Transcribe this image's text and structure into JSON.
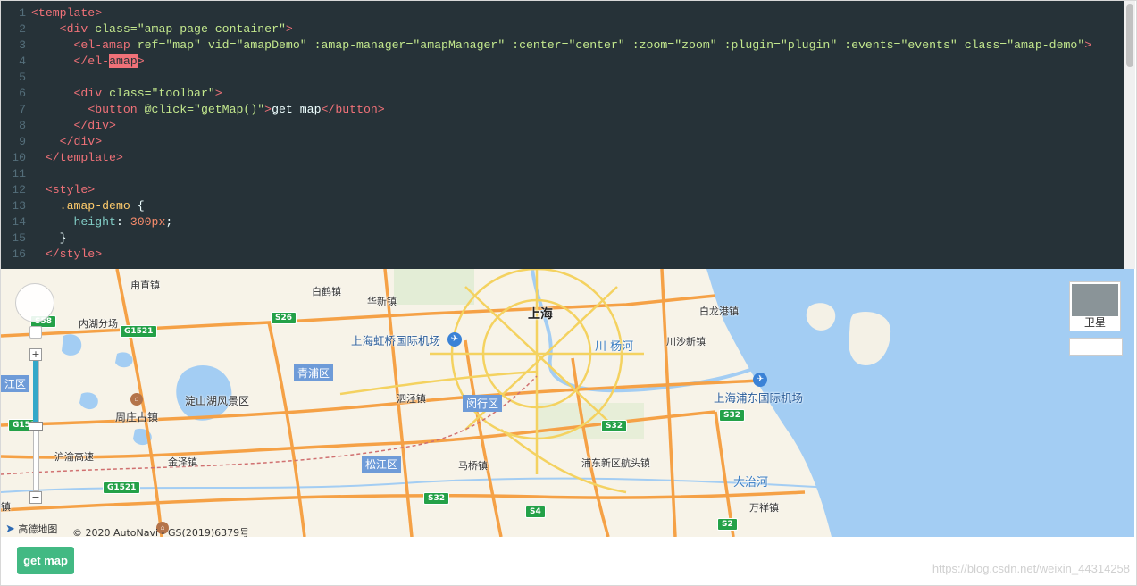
{
  "code": {
    "lines": [
      {
        "n": "1",
        "parts": [
          [
            "tag",
            "<template>"
          ]
        ]
      },
      {
        "n": "2",
        "parts": [
          [
            "plain",
            "    "
          ],
          [
            "tag",
            "<div "
          ],
          [
            "attr",
            "class="
          ],
          [
            "str",
            "\"amap-page-container\""
          ],
          [
            "tag",
            ">"
          ]
        ]
      },
      {
        "n": "3",
        "parts": [
          [
            "plain",
            "      "
          ],
          [
            "tag",
            "<el-amap "
          ],
          [
            "attr",
            "ref="
          ],
          [
            "str",
            "\"map\" "
          ],
          [
            "attr",
            "vid="
          ],
          [
            "str",
            "\"amapDemo\" "
          ],
          [
            "attr",
            ":amap-manager="
          ],
          [
            "str",
            "\"amapManager\" "
          ],
          [
            "attr",
            ":center="
          ],
          [
            "str",
            "\"center\" "
          ],
          [
            "attr",
            ":zoom="
          ],
          [
            "str",
            "\"zoom\" "
          ],
          [
            "attr",
            ":plugin="
          ],
          [
            "str",
            "\"plugin\" "
          ],
          [
            "attr",
            ":events="
          ],
          [
            "str",
            "\"events\" "
          ],
          [
            "attr",
            "class="
          ],
          [
            "str",
            "\"amap-demo\""
          ],
          [
            "tag",
            ">"
          ]
        ]
      },
      {
        "n": "4",
        "parts": [
          [
            "plain",
            "      "
          ],
          [
            "tag",
            "</el-"
          ],
          [
            "hl",
            "amap"
          ],
          [
            "tag",
            ">"
          ]
        ]
      },
      {
        "n": "5",
        "parts": []
      },
      {
        "n": "6",
        "parts": [
          [
            "plain",
            "      "
          ],
          [
            "tag",
            "<div "
          ],
          [
            "attr",
            "class="
          ],
          [
            "str",
            "\"toolbar\""
          ],
          [
            "tag",
            ">"
          ]
        ]
      },
      {
        "n": "7",
        "parts": [
          [
            "plain",
            "        "
          ],
          [
            "tag",
            "<button "
          ],
          [
            "attr",
            "@click="
          ],
          [
            "str",
            "\"getMap()\""
          ],
          [
            "tag",
            ">"
          ],
          [
            "plain",
            "get map"
          ],
          [
            "tag",
            "</button>"
          ]
        ]
      },
      {
        "n": "8",
        "parts": [
          [
            "plain",
            "      "
          ],
          [
            "tag",
            "</div>"
          ]
        ]
      },
      {
        "n": "9",
        "parts": [
          [
            "plain",
            "    "
          ],
          [
            "tag",
            "</div>"
          ]
        ]
      },
      {
        "n": "10",
        "parts": [
          [
            "plain",
            "  "
          ],
          [
            "tag",
            "</template>"
          ]
        ]
      },
      {
        "n": "11",
        "parts": []
      },
      {
        "n": "12",
        "parts": [
          [
            "plain",
            "  "
          ],
          [
            "tag",
            "<style>"
          ]
        ]
      },
      {
        "n": "13",
        "parts": [
          [
            "plain",
            "    "
          ],
          [
            "sel",
            ".amap-demo "
          ],
          [
            "plain",
            "{"
          ]
        ]
      },
      {
        "n": "14",
        "parts": [
          [
            "plain",
            "      "
          ],
          [
            "prop",
            "height"
          ],
          [
            "plain",
            ": "
          ],
          [
            "num",
            "300px"
          ],
          [
            "plain",
            ";"
          ]
        ]
      },
      {
        "n": "15",
        "parts": [
          [
            "plain",
            "    }"
          ]
        ]
      },
      {
        "n": "16",
        "parts": [
          [
            "plain",
            "  "
          ],
          [
            "tag",
            "</style>"
          ]
        ]
      }
    ]
  },
  "map": {
    "labels": {
      "shanghai": "上海",
      "hongqiao_airport": "上海虹桥国际机场",
      "pudong_airport": "上海浦东国际机场",
      "qingpu": "青浦区",
      "minhang": "闵行区",
      "songjiang": "松江区",
      "dianshan_lake": "淀山湖风景区",
      "zhouzhuang": "周庄古镇",
      "jinze": "金泽镇",
      "huxinmaoqiao": "沪渝高速",
      "chuanyanghe": "川 杨河",
      "dazhihe": "大治河",
      "chuansha": "川沙新镇",
      "gaoqiao": "白龙港镇",
      "huaxin": "华新镇",
      "baihe": "白鹤镇",
      "zhuangjia": "甪直镇",
      "neihu": "内湖分场",
      "sijing": "泗泾镇",
      "maqiao": "马桥镇",
      "pudong_hangtou": "浦东新区航头镇",
      "wanxiang": "万祥镇",
      "qu_left": "江区",
      "zhen_left": "镇"
    },
    "shields": {
      "s26": "S26",
      "g1521_top": "G1521",
      "g1521_bottom": "G1521",
      "s32_a": "S32",
      "s32_b": "S32",
      "s32_c": "S32",
      "s4": "S4",
      "s2": "S2",
      "s58": "S58",
      "g152": "G152"
    },
    "controls": {
      "zoom_in": "+",
      "zoom_out": "−",
      "zoom_level_fraction": 0.5,
      "satellite_label": "卫星"
    },
    "logo": "高德地图",
    "copyright": "© 2020 AutoNavi - GS(2019)6379号"
  },
  "toolbar": {
    "button_label": "get map"
  },
  "watermark": "https://blog.csdn.net/weixin_44314258"
}
